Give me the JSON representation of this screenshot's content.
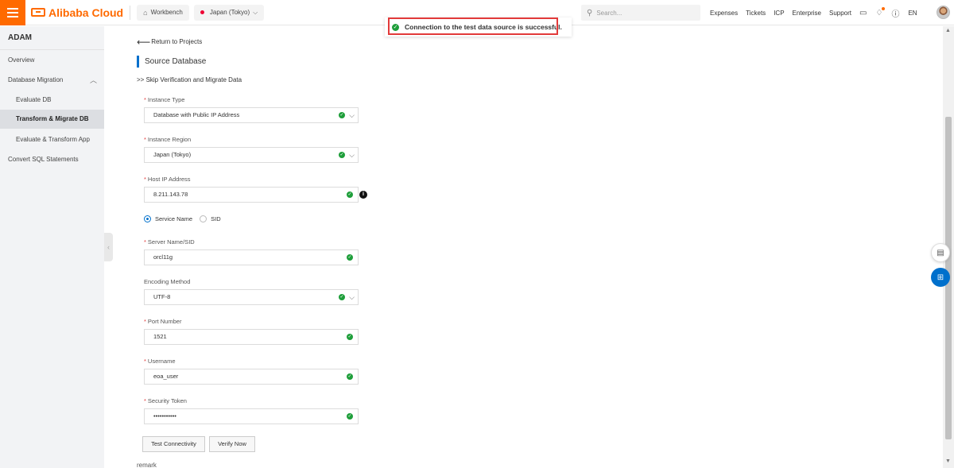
{
  "topbar": {
    "brand": "Alibaba Cloud",
    "workbench": "Workbench",
    "region": "Japan (Tokyo)",
    "search_placeholder": "Search...",
    "links": [
      "Expenses",
      "Tickets",
      "ICP",
      "Enterprise",
      "Support"
    ],
    "language": "EN"
  },
  "toast": {
    "message": "Connection to the test data source is successful."
  },
  "sidebar": {
    "title": "ADAM",
    "items": [
      {
        "label": "Overview"
      },
      {
        "label": "Database Migration"
      },
      {
        "label": "Evaluate DB"
      },
      {
        "label": "Transform & Migrate DB"
      },
      {
        "label": "Evaluate & Transform App"
      },
      {
        "label": "Convert SQL Statements"
      }
    ]
  },
  "main": {
    "return_link": "Return to Projects",
    "section_title": "Source Database",
    "skip_link": ">> Skip Verification and Migrate Data",
    "fields": {
      "instance_type": {
        "label": "Instance Type",
        "value": "Database with Public IP Address"
      },
      "instance_region": {
        "label": "Instance Region",
        "value": "Japan (Tokyo)"
      },
      "host_ip": {
        "label": "Host IP Address",
        "value": "8.211.143.78"
      },
      "server_name": {
        "label": "Server Name/SID",
        "value": "orcl11g"
      },
      "encoding": {
        "label": "Encoding Method",
        "value": "UTF-8"
      },
      "port": {
        "label": "Port Number",
        "value": "1521"
      },
      "username": {
        "label": "Username",
        "value": "eoa_user"
      },
      "token": {
        "label": "Security Token",
        "value": "•••••••••••"
      }
    },
    "radio": {
      "service_name": "Service Name",
      "sid": "SID",
      "selected": "Service Name"
    },
    "buttons": {
      "test": "Test Connectivity",
      "verify": "Verify Now"
    },
    "remark": "remark"
  },
  "colors": {
    "accent": "#ff6a00",
    "primary": "#0070cc",
    "success": "#1e9e3a",
    "highlight_box": "#e23a3a"
  }
}
